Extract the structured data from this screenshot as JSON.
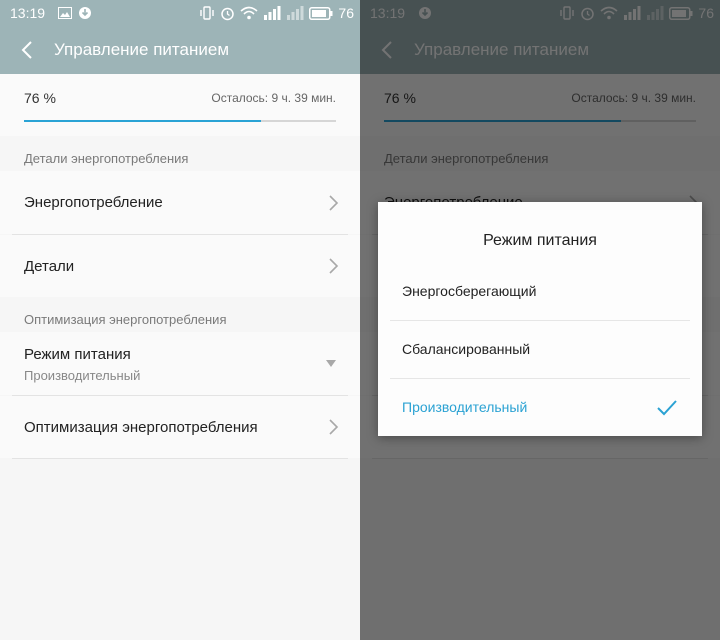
{
  "status": {
    "time": "13:19",
    "battery": "76"
  },
  "header": {
    "title": "Управление питанием"
  },
  "battery": {
    "percent_text": "76 %",
    "remaining": "Осталось: 9 ч. 39 мин.",
    "level": 0.76
  },
  "sections": {
    "details_header": "Детали энергопотребления",
    "optimization_header": "Оптимизация энергопотребления"
  },
  "items": {
    "consumption": "Энергопотребление",
    "details": "Детали",
    "power_mode": {
      "label": "Режим питания",
      "value": "Производительный"
    },
    "optimization": "Оптимизация энергопотребления"
  },
  "dialog": {
    "title": "Режим питания",
    "options": [
      "Энергосберегающий",
      "Сбалансированный",
      "Производительный"
    ],
    "selected_index": 2
  },
  "colors": {
    "accent": "#2aa3d5",
    "appbar": "#9db4b7"
  }
}
